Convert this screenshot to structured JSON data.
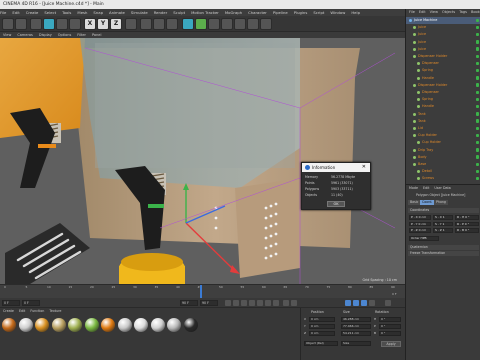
{
  "window": {
    "title": "CINEMA 4D R16 - [Juice Machine.c4d *] - Main"
  },
  "menubar": [
    "File",
    "Edit",
    "Create",
    "Select",
    "Tools",
    "Mesh",
    "Snap",
    "Animate",
    "Simulate",
    "Render",
    "Sculpt",
    "Motion Tracker",
    "MoGraph",
    "Character",
    "Pipeline",
    "Plugins",
    "Script",
    "Window",
    "Help"
  ],
  "toolbar": {
    "x_label": "X",
    "y_label": "Y",
    "z_label": "Z"
  },
  "viewport": {
    "menu": [
      "View",
      "Cameras",
      "Display",
      "Options",
      "Filter",
      "Panel"
    ],
    "grid_info": "Grid Spacing : 10 cm"
  },
  "info_dialog": {
    "title": "Information",
    "close": "✕",
    "rows": [
      {
        "label": "Memory",
        "value": "56.2778 Mbyte"
      },
      {
        "label": "Points",
        "value": "5961 (33071)"
      },
      {
        "label": "Polygons",
        "value": "5903 (33711)"
      },
      {
        "label": "Objects",
        "value": "11 (40)"
      }
    ],
    "ok_label": "OK"
  },
  "object_manager": {
    "menu": [
      "File",
      "Edit",
      "View",
      "Objects",
      "Tags",
      "Bookmarks"
    ],
    "items": [
      {
        "label": "Juice Machine",
        "depth": 0
      },
      {
        "label": "Juice",
        "depth": 1
      },
      {
        "label": "Juice",
        "depth": 1
      },
      {
        "label": "Juice",
        "depth": 1
      },
      {
        "label": "Juice",
        "depth": 1
      },
      {
        "label": "Dispenser Holder",
        "depth": 1
      },
      {
        "label": "Dispenser",
        "depth": 2
      },
      {
        "label": "Spring",
        "depth": 2
      },
      {
        "label": "Handle",
        "depth": 2
      },
      {
        "label": "Dispenser Holder",
        "depth": 1
      },
      {
        "label": "Dispenser",
        "depth": 2
      },
      {
        "label": "Spring",
        "depth": 2
      },
      {
        "label": "Handle",
        "depth": 2
      },
      {
        "label": "Tank",
        "depth": 1
      },
      {
        "label": "Tank",
        "depth": 1
      },
      {
        "label": "Lid",
        "depth": 1
      },
      {
        "label": "Cup Holder",
        "depth": 1
      },
      {
        "label": "Cup Holder",
        "depth": 2
      },
      {
        "label": "Drip Tray",
        "depth": 1
      },
      {
        "label": "Body",
        "depth": 1
      },
      {
        "label": "Base",
        "depth": 1
      },
      {
        "label": "Detail",
        "depth": 2
      },
      {
        "label": "Screws",
        "depth": 2
      }
    ]
  },
  "attribute_manager": {
    "menu": [
      "Mode",
      "Edit",
      "User Data"
    ],
    "object_title": "Polygon Object [Juice Machine]",
    "tabs": [
      "Basic",
      "Coord.",
      "Phong"
    ],
    "active_tab": "Coord.",
    "section_coordinates": "Coordinates",
    "rows": [
      {
        "p": "P . X 0 cm",
        "s": "S . X 1",
        "r": "R . H 0 °"
      },
      {
        "p": "P . Y 0 cm",
        "s": "S . Y 1",
        "r": "R . P 0 °"
      },
      {
        "p": "P . Z 0 cm",
        "s": "S . Z 1",
        "r": "R . B 0 °"
      }
    ],
    "order": "Order HPB",
    "sections": [
      "Quaternion",
      "Freeze Transformation"
    ]
  },
  "timeline": {
    "ticks": [
      "0",
      "5",
      "10",
      "15",
      "20",
      "25",
      "30",
      "35",
      "40",
      "45",
      "50",
      "55",
      "60",
      "65",
      "70",
      "75",
      "80",
      "85",
      "90"
    ],
    "end_label": "0 F"
  },
  "transport": {
    "start": "0 F",
    "current": "0 F",
    "end": "90 F",
    "end2": "90 F"
  },
  "material_manager": {
    "menu": [
      "Create",
      "Edit",
      "Function",
      "Texture"
    ],
    "materials": [
      "#c46a1a",
      "#cfcfcf",
      "#d89020",
      "#b8a060",
      "#9fb050",
      "#7ab840",
      "#e07a10",
      "#c8c8c8",
      "#dcdcdc",
      "#d0d0d0",
      "#b8b8b8",
      "#2a2a2a"
    ]
  },
  "coordinates_manager": {
    "headers": [
      "Position",
      "Size",
      "Rotation"
    ],
    "rows": [
      {
        "axis": "X",
        "pos": "0 cm",
        "size": "46.288 cm",
        "rot_axis": "H",
        "rot": "0 °"
      },
      {
        "axis": "Y",
        "pos": "0 cm",
        "size": "77.466 cm",
        "rot_axis": "P",
        "rot": "0 °"
      },
      {
        "axis": "Z",
        "pos": "0 cm",
        "size": "54.211 cm",
        "rot_axis": "B",
        "rot": "0 °"
      }
    ],
    "mode": "Object (Rel)",
    "size_mode": "Size",
    "apply": "Apply"
  },
  "colors": {
    "accent": "#3b7bd4",
    "status_green": "#3bb34a"
  }
}
